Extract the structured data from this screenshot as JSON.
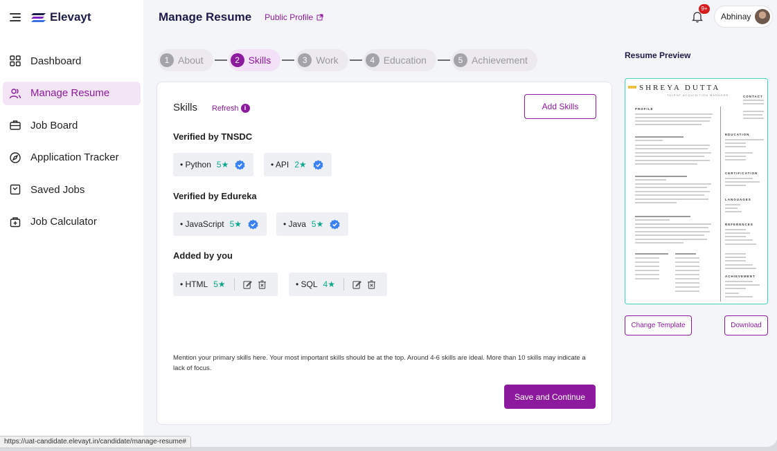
{
  "app": {
    "name": "Elevayt"
  },
  "sidebar": {
    "items": [
      {
        "label": "Dashboard",
        "icon": "grid-icon",
        "active": false
      },
      {
        "label": "Manage Resume",
        "icon": "users-icon",
        "active": true
      },
      {
        "label": "Job Board",
        "icon": "briefcase-icon",
        "active": false
      },
      {
        "label": "Application Tracker",
        "icon": "compass-icon",
        "active": false
      },
      {
        "label": "Saved Jobs",
        "icon": "bookmark-check-icon",
        "active": false
      },
      {
        "label": "Job Calculator",
        "icon": "calculator-icon",
        "active": false
      }
    ]
  },
  "header": {
    "title": "Manage Resume",
    "public_profile": "Public Profile",
    "notification_badge": "9+",
    "user_name": "Abhinay"
  },
  "stepper": {
    "steps": [
      {
        "num": "1",
        "label": "About"
      },
      {
        "num": "2",
        "label": "Skills"
      },
      {
        "num": "3",
        "label": "Work"
      },
      {
        "num": "4",
        "label": "Education"
      },
      {
        "num": "5",
        "label": "Achievement"
      }
    ],
    "active_index": 1
  },
  "skills": {
    "title": "Skills",
    "refresh": "Refresh",
    "add_button": "Add Skills",
    "groups": [
      {
        "title": "Verified by TNSDC",
        "skills": [
          {
            "name": "• Python",
            "rating": "5★"
          },
          {
            "name": "• API",
            "rating": "2★"
          }
        ]
      },
      {
        "title": "Verified by Edureka",
        "skills": [
          {
            "name": "• JavaScript",
            "rating": "5★"
          },
          {
            "name": "• Java",
            "rating": "5★"
          }
        ]
      },
      {
        "title": "Added by you",
        "skills": [
          {
            "name": "• HTML",
            "rating": "5★"
          },
          {
            "name": "• SQL",
            "rating": "4★"
          }
        ]
      }
    ],
    "hint": "Mention your primary skills here. Your most important skills should be at the top. Around 4-6 skills are ideal. More than 10 skills may indicate a lack of focus.",
    "save_button": "Save and Continue"
  },
  "preview": {
    "title": "Resume Preview",
    "resume_name": "SHREYA DUTTA",
    "resume_role": "TALENT ACQUISITION MANAGER",
    "contact": "CONTACT",
    "sections_left": [
      "PROFILE"
    ],
    "sections_right": [
      "EDUCATION",
      "CERTIFICATION",
      "LANGUAGES",
      "REFERENCES",
      "ACHIEVEMENT"
    ],
    "change_template": "Change Template",
    "download": "Download"
  },
  "status_url": "https://uat-candidate.elevayt.in/candidate/manage-resume#",
  "colors": {
    "accent": "#8d1a9e",
    "star": "#0fa88d",
    "verified": "#3b82f6",
    "preview_border": "#3fd4b5"
  }
}
